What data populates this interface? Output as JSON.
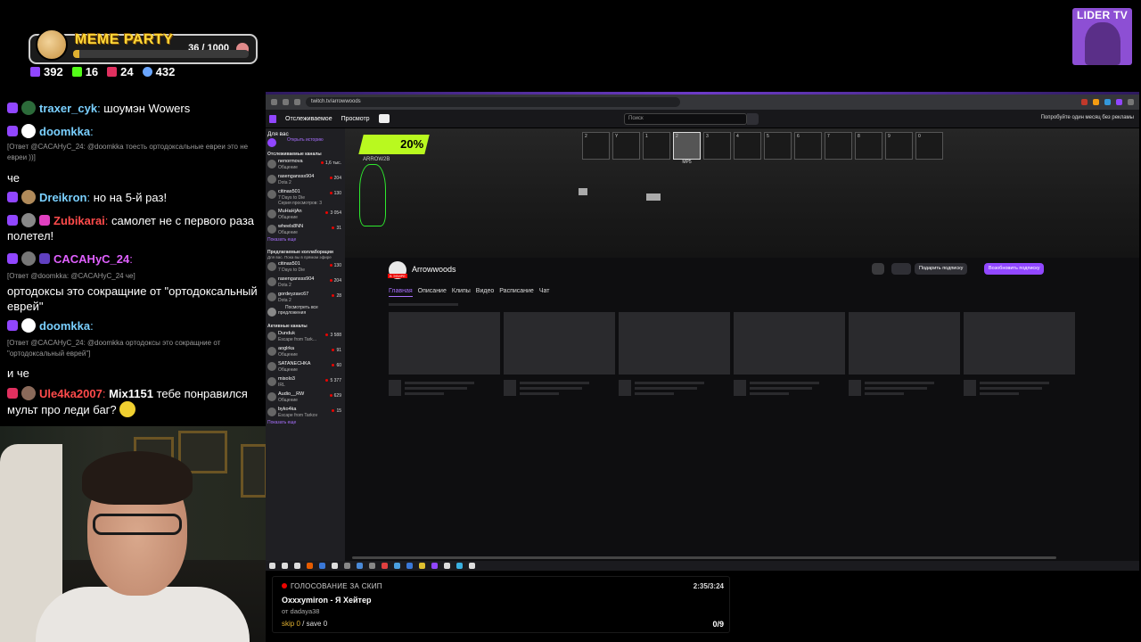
{
  "overlay": {
    "meme_title": "MEME PARTY",
    "meme_progress": "36 / 1000",
    "meme_progress_fraction": 0.036,
    "stats": [
      {
        "icon": "twitch-icon",
        "color": "#9146ff",
        "value": "392"
      },
      {
        "icon": "kick-icon",
        "color": "#53fc18",
        "value": "16"
      },
      {
        "icon": "vk-live-icon",
        "color": "#e0305f",
        "value": "24"
      },
      {
        "icon": "viewers-icon",
        "color": "#6aa6ff",
        "value": "432"
      }
    ]
  },
  "chat": {
    "messages": [
      {
        "user": "traxer_cyk",
        "user_color": "#7ad0ff",
        "text": "шоумэн Wowers"
      },
      {
        "user": "doomkka",
        "user_color": "#7ad0ff",
        "text": ""
      },
      {
        "reply": "[Ответ @CACAHyC_24: @doomkka тоесть ортодоксальные евреи это не евреи ))]"
      },
      {
        "text_only": "че"
      },
      {
        "user": "Dreikron",
        "user_color": "#7ad0ff",
        "text": "но на 5-й раз!"
      },
      {
        "user": "Zubikarai",
        "user_color": "#ff4b4b",
        "text": "самолет не с первого раза полетел!"
      },
      {
        "user": "CACAHyC_24",
        "user_color": "#e060ff",
        "text": ""
      },
      {
        "reply": "[Ответ @doomkka: @CACAHyC_24 че]"
      },
      {
        "text_only": "ортодоксы это сокращние от \"ортодоксальный еврей\""
      },
      {
        "user": "doomkka",
        "user_color": "#7ad0ff",
        "text": ""
      },
      {
        "reply": "[Ответ @CACAHyC_24: @doomkka ортодоксы это сокращние от \"ортодоксальный еврей\"]"
      },
      {
        "text_only": "и че"
      },
      {
        "user": "Ule4ka2007",
        "user_color": "#ff4b4b",
        "mention": "Mix1151",
        "text": "тебе понравился мульт про леди баг?"
      }
    ]
  },
  "lider": {
    "title": "LIDER TV"
  },
  "browser": {
    "url": "twitch.tv/arrowwoods",
    "nav_following": "Отслеживаемое",
    "nav_browse": "Просмотр",
    "search_placeholder": "Поиск",
    "promo": "Попробуйте один месяц без рекламы",
    "sidebar": {
      "for_you": "Для вас",
      "history": "Открыть историю",
      "followed_title": "Отслеживаемые каналы",
      "followed": [
        {
          "name": "nenormova",
          "game": "Общение",
          "viewers": "1,6 тыс."
        },
        {
          "name": "rasengansss904",
          "game": "Dota 2",
          "viewers": "204"
        },
        {
          "name": "citinas501",
          "game": "7 Days to Die",
          "viewers": "130",
          "extra": "Серия просмотров: 3"
        },
        {
          "name": "MuHaHjAn",
          "game": "Общение",
          "viewers": "3 054"
        },
        {
          "name": "wheels8NN",
          "game": "Общение",
          "viewers": "31"
        }
      ],
      "show_more": "Показать еще",
      "collab_title": "Предлагаемые коллаборации",
      "collab_sub": "Для вас. Пока вы в прямом эфире",
      "collab": [
        {
          "name": "citinas501",
          "game": "7 Days to Die",
          "viewers": "130"
        },
        {
          "name": "rasengansss904",
          "game": "Dota 2",
          "viewers": "204"
        },
        {
          "name": "gordeyzavc67",
          "game": "Dota 2",
          "viewers": "28"
        }
      ],
      "all_suggestions": "Посмотреть все предложения",
      "active_title": "Активные каналы",
      "active": [
        {
          "name": "Dunduk",
          "game": "Escape from Tark...",
          "viewers": "3 588"
        },
        {
          "name": "aoglrka",
          "game": "Общение",
          "viewers": "91"
        },
        {
          "name": "SATANECHKA",
          "game": "Общение",
          "viewers": "60"
        },
        {
          "name": "misolo3",
          "game": "IRL",
          "viewers": "5 377"
        },
        {
          "name": "Audio__RW",
          "game": "Общение",
          "viewers": "629"
        },
        {
          "name": "byko4ka",
          "game": "Escape from Tarkov",
          "viewers": "15"
        }
      ],
      "show_more2": "Показать еще"
    },
    "game": {
      "offer": "20%",
      "slots": [
        "2",
        "Y",
        "1",
        "2",
        "3",
        "4",
        "5",
        "6",
        "7",
        "8",
        "9",
        "0"
      ],
      "weapon_label": "MP5",
      "brand": "ARROW2B"
    },
    "channel": {
      "name": "Arrowwoods",
      "live_badge": "В ЭФИРЕ",
      "gift_btn": "Подарить подписку",
      "resub_btn": "Возобновить подписку",
      "tabs": [
        "Главная",
        "Описание",
        "Клипы",
        "Видео",
        "Расписание",
        "Чат"
      ]
    }
  },
  "song": {
    "label": "ГОЛОСОВАНИЕ ЗА СКИП",
    "time": "2:35/3:24",
    "title": "Oxxxymiron - Я Хейтер",
    "by": "от dadaya38",
    "skip": "skip 0",
    "save": "save 0",
    "count": "0/9"
  }
}
